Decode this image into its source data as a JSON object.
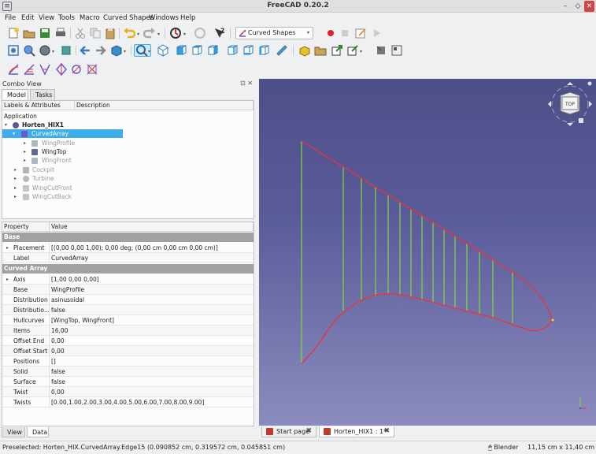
{
  "window": {
    "title": "FreeCAD 0.20.2"
  },
  "menu": [
    "File",
    "Edit",
    "View",
    "Tools",
    "Macro",
    "Curved Shapes",
    "Windows",
    "Help"
  ],
  "workbench": {
    "selected": "Curved Shapes"
  },
  "combo": {
    "title": "Combo View",
    "tabs": [
      "Model",
      "Tasks"
    ],
    "bottom_tabs": [
      "View",
      "Data"
    ]
  },
  "tree": {
    "headers": [
      "Labels & Attributes",
      "Description"
    ],
    "root": "Application",
    "items": [
      {
        "label": "Horten_HIX1",
        "icon": "document-icon"
      },
      {
        "label": "CurvedArray",
        "icon": "curved-array-icon"
      },
      {
        "label": "WingProfile",
        "icon": "sketch-icon"
      },
      {
        "label": "WingTop",
        "icon": "sketch-icon"
      },
      {
        "label": "WingFront",
        "icon": "sketch-icon"
      },
      {
        "label": "Cockpit",
        "icon": "sketch-icon"
      },
      {
        "label": "Turbine",
        "icon": "part-icon"
      },
      {
        "label": "WingCutFront",
        "icon": "cut-icon"
      },
      {
        "label": "WingCutBack",
        "icon": "cut-icon"
      }
    ]
  },
  "properties": {
    "headers": [
      "Property",
      "Value"
    ],
    "groups": [
      {
        "name": "Base",
        "rows": [
          {
            "name": "Placement",
            "value": "[(0,00 0,00 1,00); 0,00 deg; (0,00 cm  0,00 cm  0,00 cm)]"
          },
          {
            "name": "Label",
            "value": "CurvedArray"
          }
        ]
      },
      {
        "name": "Curved Array",
        "rows": [
          {
            "name": "Axis",
            "value": "[1,00 0,00 0,00]"
          },
          {
            "name": "Base",
            "value": "WingProfile"
          },
          {
            "name": "Distribution",
            "value": "asinusoidal"
          },
          {
            "name": "Distributio...",
            "value": "false"
          },
          {
            "name": "Hullcurves",
            "value": "[WingTop, WingFront]"
          },
          {
            "name": "Items",
            "value": "16,00"
          },
          {
            "name": "Offset End",
            "value": "0,00"
          },
          {
            "name": "Offset Start",
            "value": "0,00"
          },
          {
            "name": "Positions",
            "value": "[]"
          },
          {
            "name": "Solid",
            "value": "false"
          },
          {
            "name": "Surface",
            "value": "false"
          },
          {
            "name": "Twist",
            "value": "0,00"
          },
          {
            "name": "Twists",
            "value": "[0.00,1.00,2.00,3.00,4.00,5.00,6.00,7.00,8.00,9.00]"
          }
        ]
      }
    ]
  },
  "navcube": {
    "face": "TOP"
  },
  "doc_tabs": [
    {
      "label": "Start page"
    },
    {
      "label": "Horten_HIX1 : 1*"
    }
  ],
  "status": {
    "message": "Preselected: Horten_HIX.CurvedArray.Edge15 (0.090852 cm, 0.319572 cm, 0.045851 cm)",
    "navigation": "Blender",
    "dimensions": "11,15 cm x 11,40 cm"
  },
  "colors": {
    "selection": "#3daee9",
    "curve_red": "#e8343c",
    "section_green": "#7ddc3a",
    "viewport_top": "#4e4f88",
    "viewport_bottom": "#8b8cbd"
  }
}
